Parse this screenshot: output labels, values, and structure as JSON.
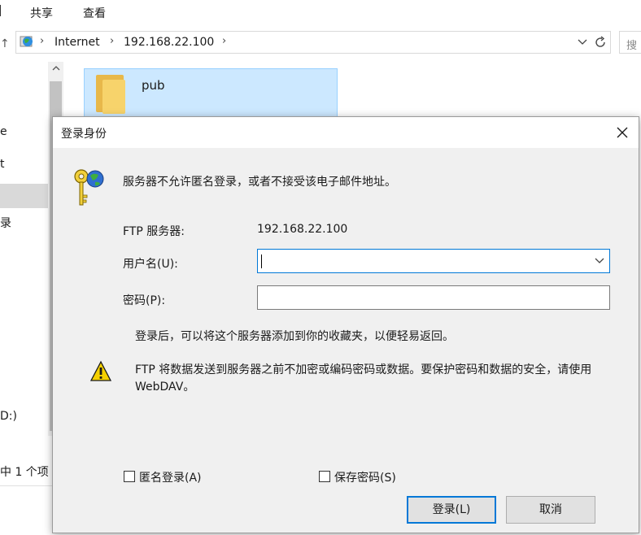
{
  "ribbon": {
    "tabs": [
      "共享",
      "查看"
    ],
    "partial_tab": ""
  },
  "address": {
    "crumbs": [
      "Internet",
      "192.168.22.100"
    ],
    "search_placeholder": "搜"
  },
  "nav": {
    "fragments": [
      "e",
      "t",
      "录",
      "D:)"
    ]
  },
  "files": [
    {
      "name": "pub"
    }
  ],
  "status": {
    "selection": "中 1 个项"
  },
  "dialog": {
    "title": "登录身份",
    "message": "服务器不允许匿名登录，或者不接受该电子邮件地址。",
    "ftp_server_label": "FTP 服务器:",
    "ftp_server_value": "192.168.22.100",
    "username_label": "用户名(U):",
    "username_value": "",
    "password_label": "密码(P):",
    "password_value": "",
    "favorites_hint": "登录后，可以将这个服务器添加到你的收藏夹，以便轻易返回。",
    "warning_line1": "FTP 将数据发送到服务器之前不加密或编码密码或数据。要保护密码和数据的安全，请使用",
    "warning_line2": "WebDAV。",
    "anonymous_label": "匿名登录(A)",
    "save_password_label": "保存密码(S)",
    "login_button": "登录(L)",
    "cancel_button": "取消"
  },
  "colors": {
    "accent": "#0078d7",
    "selection": "#cce8ff",
    "dialog_bg": "#f0f0f0",
    "folder": "#f7d36b"
  }
}
